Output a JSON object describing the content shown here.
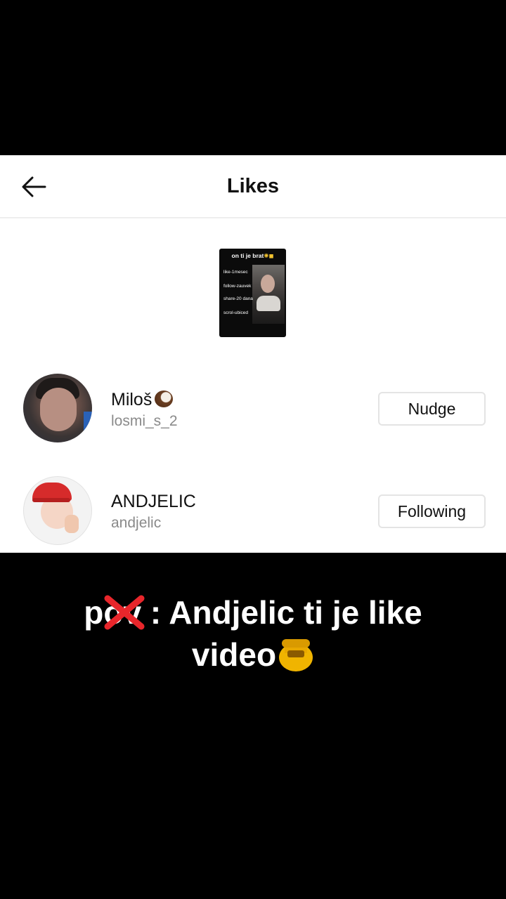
{
  "header": {
    "title": "Likes"
  },
  "thumbnail": {
    "title": "on ti je brat",
    "lines": [
      "like-1mesec",
      "follow-zauvek",
      "share-20 dana",
      "scrol-ubiced"
    ]
  },
  "users": [
    {
      "name": "Miloš",
      "handle": "losmi_s_2",
      "button": "Nudge"
    },
    {
      "name": "ANDJELIC",
      "handle": "andjelic",
      "button": "Following"
    }
  ],
  "caption": {
    "line1_start": "p",
    "line1_struck": "o",
    "line1_rest": "v : Andjelic ti je like",
    "line2": "video"
  },
  "colors": {
    "cross": "#e8262b",
    "honey": "#f0b400"
  }
}
